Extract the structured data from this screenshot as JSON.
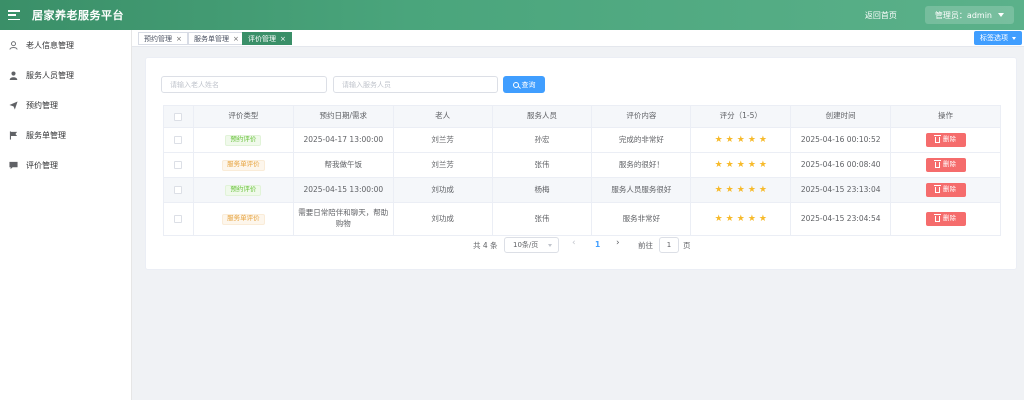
{
  "header": {
    "title": "居家养老服务平台",
    "home_link": "返回首页",
    "admin_label": "管理员：admin"
  },
  "sidebar": {
    "items": [
      {
        "label": "老人信息管理",
        "icon": "user-icon"
      },
      {
        "label": "服务人员管理",
        "icon": "person-icon"
      },
      {
        "label": "预约管理",
        "icon": "send-icon"
      },
      {
        "label": "服务单管理",
        "icon": "flag-icon"
      },
      {
        "label": "评价管理",
        "icon": "message-icon"
      }
    ]
  },
  "tabs": {
    "items": [
      {
        "label": "预约管理",
        "active": false
      },
      {
        "label": "服务单管理",
        "active": false
      },
      {
        "label": "评价管理",
        "active": true
      }
    ],
    "close_glyph": "×",
    "options_label": "标签选项"
  },
  "search": {
    "elder_placeholder": "请输入老人姓名",
    "staff_placeholder": "请输入服务人员",
    "button_label": "查询"
  },
  "table": {
    "headers": [
      "评价类型",
      "预约日期/需求",
      "老人",
      "服务人员",
      "评价内容",
      "评分（1-5）",
      "创建时间",
      "操作"
    ],
    "delete_label": "删除",
    "rows": [
      {
        "type": "预约评价",
        "type_color": "green",
        "date": "2025-04-17 13:00:00",
        "elder": "刘兰芳",
        "staff": "孙宏",
        "content": "完成的非常好",
        "rating": 5,
        "created": "2025-04-16 00:10:52"
      },
      {
        "type": "服务单评价",
        "type_color": "orange",
        "date": "帮我做午饭",
        "elder": "刘兰芳",
        "staff": "张伟",
        "content": "服务的很好！",
        "rating": 5,
        "created": "2025-04-16 00:08:40"
      },
      {
        "type": "预约评价",
        "type_color": "green",
        "date": "2025-04-15 13:00:00",
        "elder": "刘功成",
        "staff": "杨梅",
        "content": "服务人员服务很好",
        "rating": 5,
        "created": "2025-04-15 23:13:04"
      },
      {
        "type": "服务单评价",
        "type_color": "orange",
        "date": "需要日常陪伴和聊天，帮助购物",
        "elder": "刘功成",
        "staff": "张伟",
        "content": "服务非常好",
        "rating": 5,
        "created": "2025-04-15 23:04:54"
      }
    ]
  },
  "pagination": {
    "total": "共 4 条",
    "page_size": "10条/页",
    "prev_glyph": "‹",
    "current_page": "1",
    "next_glyph": "›",
    "goto_label": "前往",
    "goto_value": "1",
    "page_unit": "页"
  },
  "colors": {
    "brand": "#3a8f68",
    "primary": "#409eff",
    "danger": "#f56c6c",
    "star": "#f7ba2a"
  }
}
